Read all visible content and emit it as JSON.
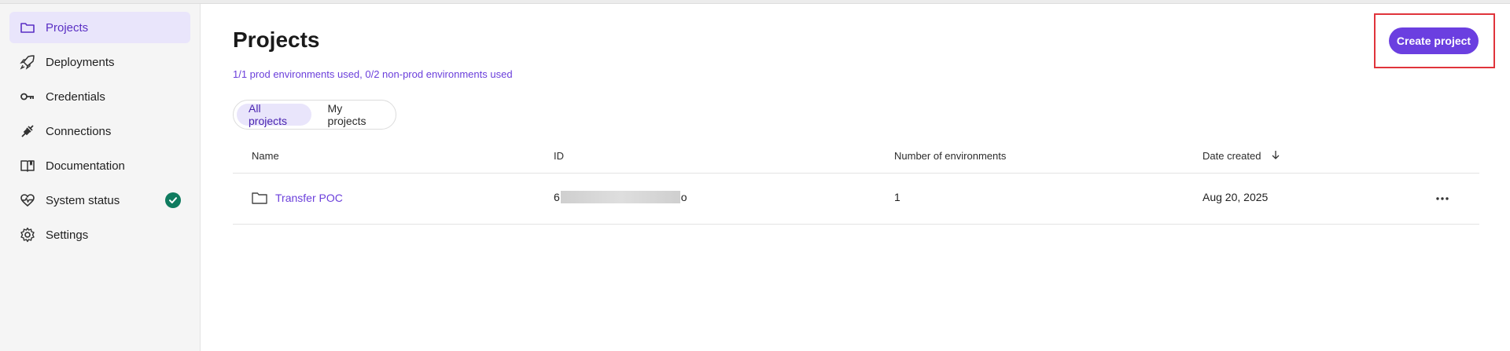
{
  "sidebar": {
    "items": [
      {
        "label": "Projects",
        "icon": "folder-icon",
        "active": true
      },
      {
        "label": "Deployments",
        "icon": "rocket-icon"
      },
      {
        "label": "Credentials",
        "icon": "key-icon"
      },
      {
        "label": "Connections",
        "icon": "plug-icon"
      },
      {
        "label": "Documentation",
        "icon": "book-icon"
      },
      {
        "label": "System status",
        "icon": "heartbeat-icon",
        "status": "check-circle-icon"
      },
      {
        "label": "Settings",
        "icon": "gear-icon"
      }
    ]
  },
  "page": {
    "title": "Projects",
    "usage": "1/1 prod environments used, 0/2 non-prod environments used",
    "create_label": "Create project"
  },
  "tabs": [
    {
      "label": "All projects",
      "active": true
    },
    {
      "label": "My projects",
      "active": false
    }
  ],
  "table": {
    "headers": {
      "name": "Name",
      "id": "ID",
      "envs": "Number of environments",
      "date": "Date created"
    },
    "rows": [
      {
        "name": "Transfer POC",
        "id_start": "6",
        "id_end": "o",
        "envs": "1",
        "date": "Aug 20, 2025"
      }
    ]
  },
  "colors": {
    "accent": "#6b3fe0",
    "active_bg": "#e9e5fb",
    "status_ok": "#0f7b5f",
    "highlight": "#e0343b"
  }
}
